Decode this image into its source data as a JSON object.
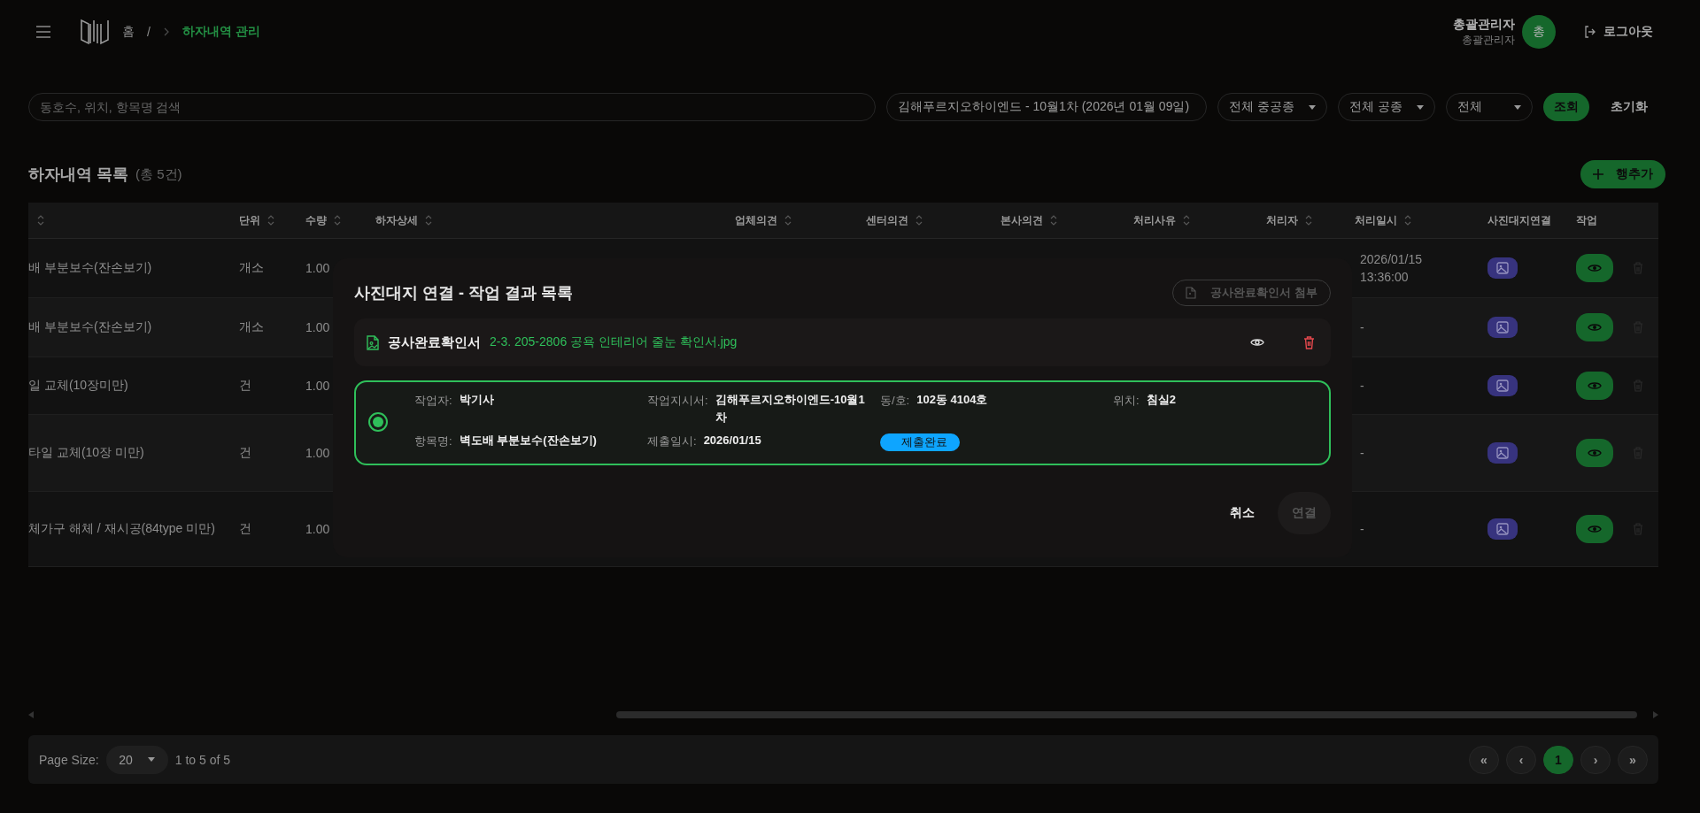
{
  "header": {
    "home": "홈",
    "separator": "/",
    "current": "하자내역 관리",
    "user_name": "총괄관리자",
    "user_role": "총괄관리자",
    "avatar": "총",
    "logout": "로그아웃"
  },
  "filters": {
    "search_placeholder": "동호수, 위치, 항목명 검색",
    "selects": [
      "김해푸르지오하이엔드 - 10월1차 (2026년 01월 09일)",
      "전체 중공종",
      "전체 공종",
      "전체"
    ],
    "search_button": "조회",
    "reset_button": "초기화"
  },
  "list": {
    "title": "하자내역 목록",
    "count": "(총 5건)",
    "add_button": "행추가"
  },
  "table": {
    "columns": [
      "단위",
      "수량",
      "하자상세",
      "업체의견",
      "센터의견",
      "본사의견",
      "처리사유",
      "처리자",
      "처리일시",
      "사진대지연결",
      "작업"
    ],
    "rows": [
      {
        "item": "배 부분보수(잔손보기)",
        "unit": "개소",
        "qty": "1.00",
        "processed_at": [
          "2026/01/15",
          "13:36:00"
        ]
      },
      {
        "item": "배 부분보수(잔손보기)",
        "unit": "개소",
        "qty": "1.00",
        "processed_at": [
          "-"
        ]
      },
      {
        "item": "일 교체(10장미만)",
        "unit": "건",
        "qty": "1.00",
        "processed_at": [
          "-"
        ]
      },
      {
        "item": "타일 교체(10장 미만)",
        "unit": "건",
        "qty": "1.00",
        "processed_at": [
          "-"
        ]
      },
      {
        "item": "체가구 해체 / 재시공(84type 미만)",
        "unit": "건",
        "qty": "1.00",
        "processed_at": [
          "-"
        ]
      }
    ]
  },
  "pagination": {
    "page_size_label": "Page Size:",
    "page_size": "20",
    "range": "1 to 5 of 5",
    "first": "«",
    "prev": "‹",
    "pages": [
      {
        "label": "1",
        "selected": true
      }
    ],
    "next": "›",
    "last": "»"
  },
  "modal": {
    "title": "사진대지 연결 - 작업 결과 목록",
    "attach_button": "공사완료확인서 첨부",
    "file": {
      "label": "공사완료확인서",
      "name": "2-3. 205-2806 공욕 인테리어 줄눈 확인서.jpg"
    },
    "results": [
      {
        "selected": true,
        "fields": [
          {
            "label": "작업자:",
            "value": "박기사"
          },
          {
            "label": "작업지시서:",
            "value": "김해푸르지오하이엔드-10월1차"
          },
          {
            "label": "동/호:",
            "value": "102동 4104호"
          },
          {
            "label": "위치:",
            "value": "침실2"
          },
          {
            "label": "항목명:",
            "value": "벽도배 부분보수(잔손보기)"
          },
          {
            "label": "제출일시:",
            "value": "2026/01/15"
          }
        ],
        "status": "제출완료"
      }
    ],
    "cancel_button": "취소",
    "connect_button": "연결"
  }
}
